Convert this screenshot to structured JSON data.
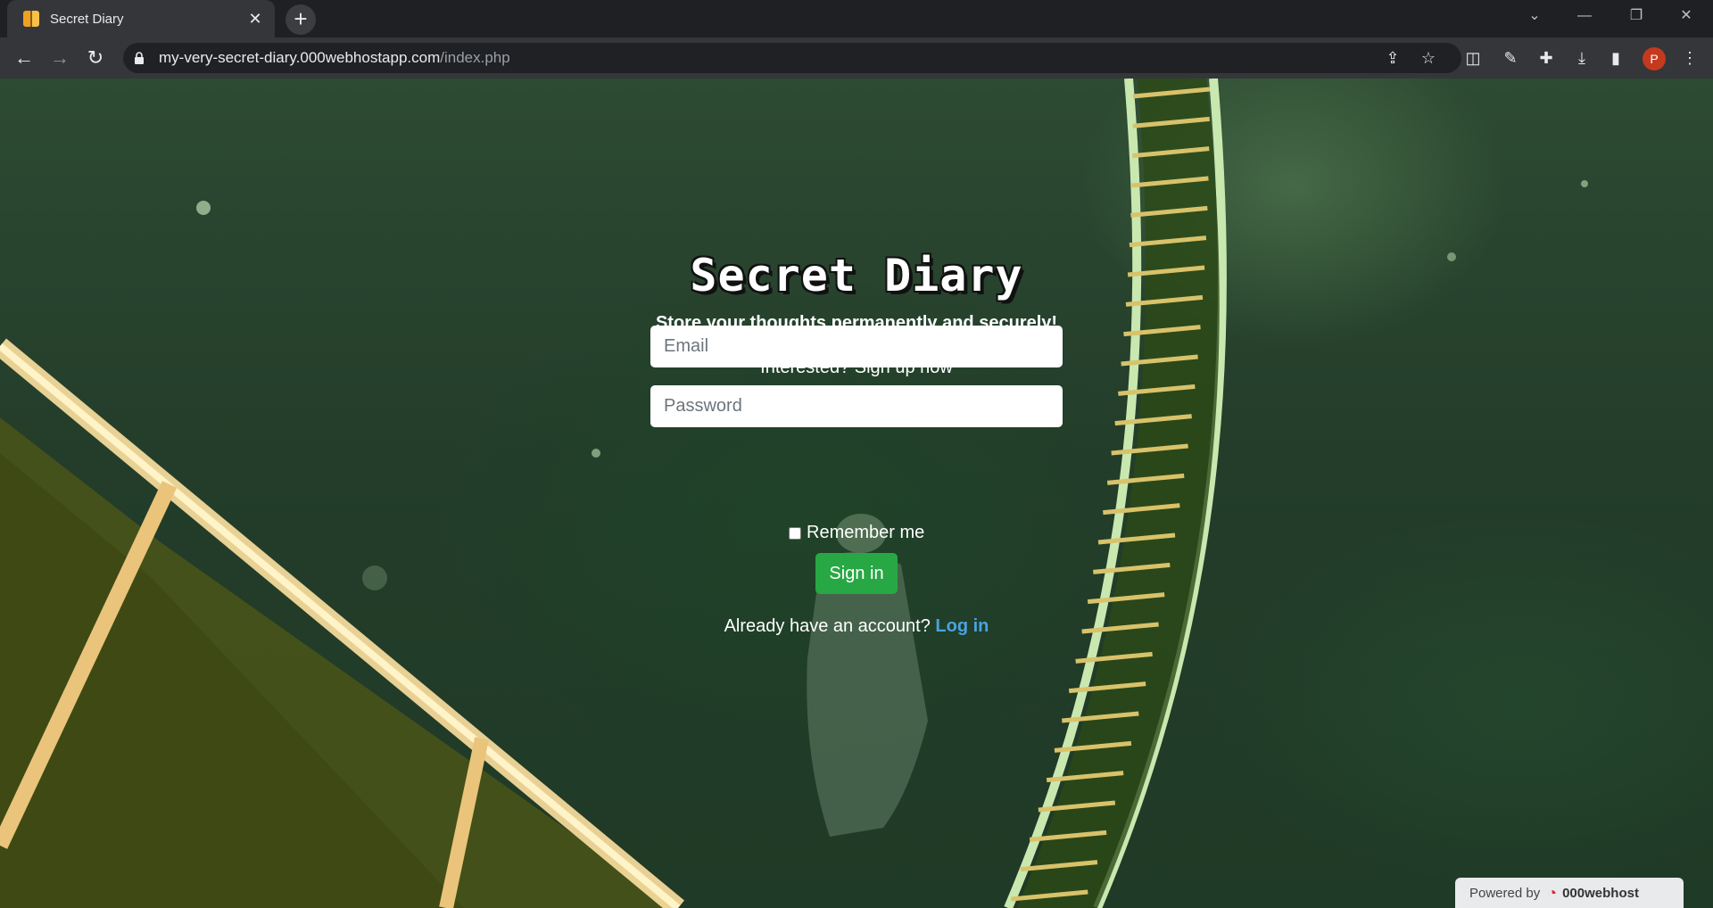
{
  "browser": {
    "tab_title": "Secret Diary",
    "tab_close": "✕",
    "new_tab": "+",
    "url_host": "my-very-secret-diary.000webhostapp.com",
    "url_path": "/index.php",
    "profile_initial": "P",
    "icons": [
      "back-icon",
      "forward-icon",
      "reload-icon",
      "lock-icon",
      "share-icon",
      "star-icon",
      "extension-icon",
      "puzzle-icon",
      "download-icon",
      "sidepanel-icon",
      "menu-icon"
    ]
  },
  "page": {
    "title": "Secret Diary",
    "tagline": "Store your thoughts permanently and securely!",
    "prompt": "Interested? Sign up now",
    "email_placeholder": "Email",
    "password_placeholder": "Password",
    "remember_label": "Remember me",
    "signin_label": "Sign in",
    "already_text": "Already have an account?",
    "login_link": "Log in"
  },
  "footer": {
    "powered_by": "Powered by",
    "brand": "000webhost"
  },
  "colors": {
    "signin_button": "#28a745",
    "login_link": "#4aa3df"
  }
}
